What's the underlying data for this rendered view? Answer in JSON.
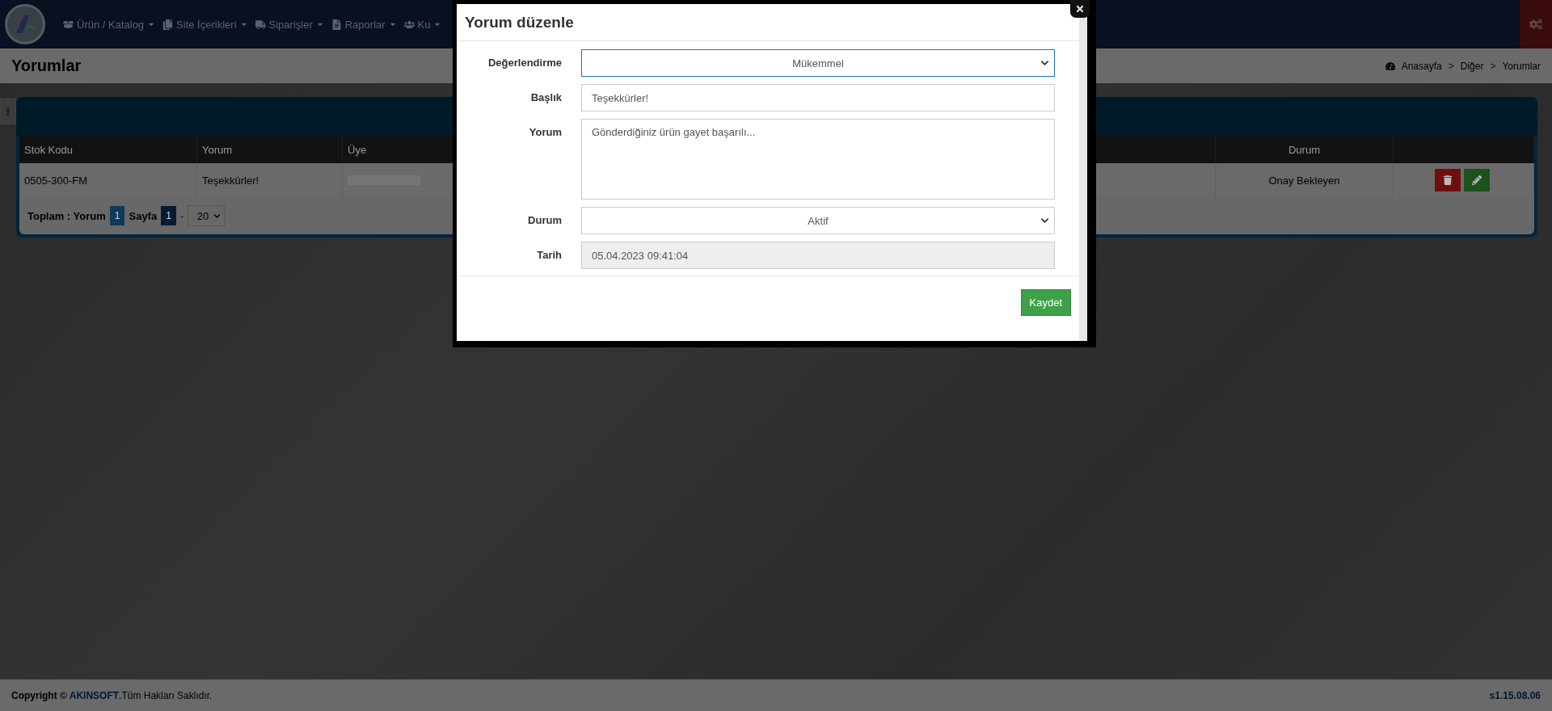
{
  "nav": {
    "items": [
      {
        "label": "Ürün / Katalog"
      },
      {
        "label": "Site İçerikleri"
      },
      {
        "label": "Siparişler"
      },
      {
        "label": "Raporlar"
      },
      {
        "label": "Ku"
      }
    ]
  },
  "page": {
    "title": "Yorumlar",
    "breadcrumb": [
      "Anasayfa",
      "Diğer",
      "Yorumlar"
    ],
    "breadcrumb_separators": [
      ">",
      ">"
    ]
  },
  "table": {
    "columns": [
      "Stok Kodu",
      "Yorum",
      "Üye",
      "Durum"
    ],
    "rows": [
      {
        "stock_code": "0505-300-FM",
        "comment": "Teşekkürler!",
        "status": "Onay Bekleyen"
      }
    ]
  },
  "pagination": {
    "total_label": "Toplam : Yorum",
    "total": "1",
    "page_label": "Sayfa",
    "page": "1",
    "separator": "-",
    "page_size": "20"
  },
  "modal": {
    "title": "Yorum düzenle",
    "fields": [
      {
        "kind": "select",
        "label": "Değerlendirme",
        "value": "Mükemmel",
        "focused": true,
        "disabled": false
      },
      {
        "kind": "text",
        "label": "Başlık",
        "value": "Teşekkürler!",
        "focused": false,
        "disabled": false
      },
      {
        "kind": "textarea",
        "label": "Yorum",
        "value": "Gönderdiğiniz ürün gayet başarılı...",
        "focused": false,
        "disabled": false
      },
      {
        "kind": "select",
        "label": "Durum",
        "value": "Aktif",
        "focused": false,
        "disabled": false
      },
      {
        "kind": "text",
        "label": "Tarih",
        "value": "05.04.2023 09:41:04",
        "focused": false,
        "disabled": true
      }
    ],
    "save_button": "Kaydet"
  },
  "footer": {
    "copyright": "Copyright ©",
    "brand": "AKINSOFT",
    "rights": ".Tüm Hakları Saklıdır.",
    "version": "s1.15.08.06"
  }
}
